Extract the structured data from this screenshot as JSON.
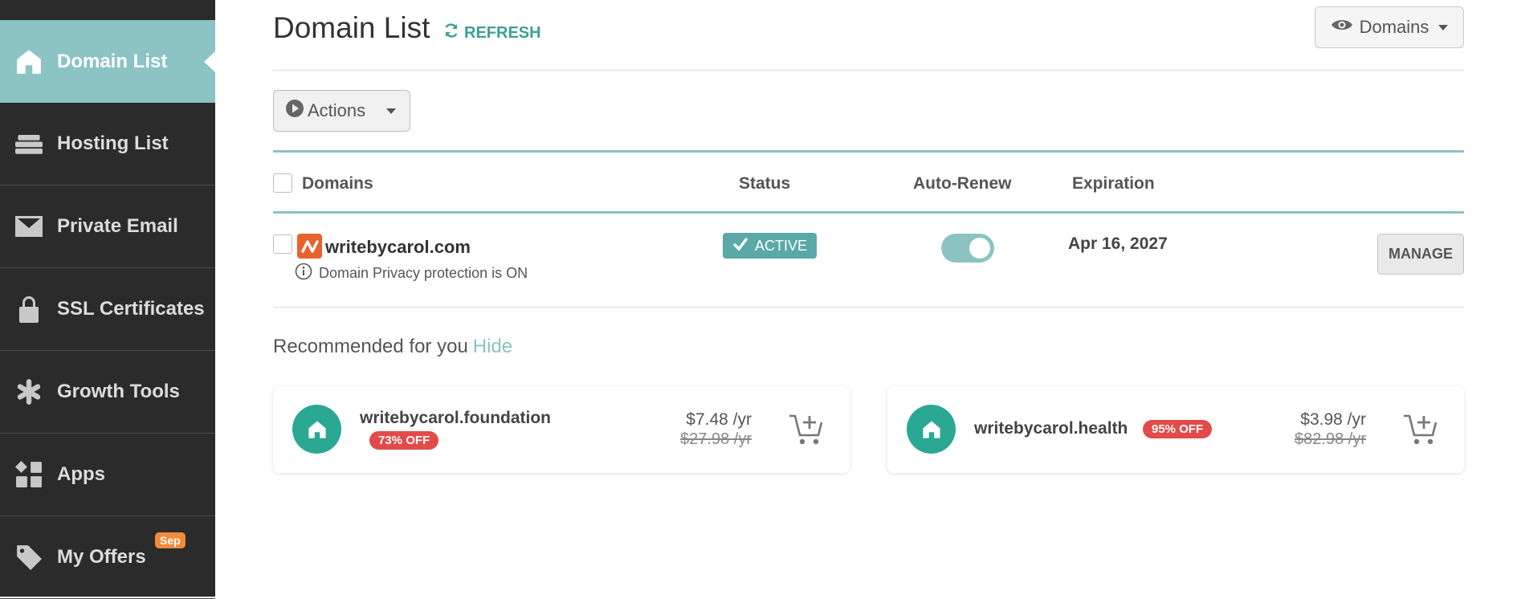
{
  "sidebar": {
    "items": [
      {
        "label": "Domain List",
        "icon": "home-icon",
        "active": true
      },
      {
        "label": "Hosting List",
        "icon": "server-icon"
      },
      {
        "label": "Private Email",
        "icon": "envelope-icon"
      },
      {
        "label": "SSL Certificates",
        "icon": "lock-icon"
      },
      {
        "label": "Growth Tools",
        "icon": "asterisk-icon"
      },
      {
        "label": "Apps",
        "icon": "apps-grid-icon"
      },
      {
        "label": "My Offers",
        "icon": "tag-icon",
        "badge": "Sep"
      }
    ]
  },
  "header": {
    "title": "Domain List",
    "refresh_label": "REFRESH",
    "view_dropdown_label": "Domains"
  },
  "toolbar": {
    "actions_label": "Actions"
  },
  "table": {
    "columns": [
      "Domains",
      "Status",
      "Auto-Renew",
      "Expiration"
    ],
    "rows": [
      {
        "domain": "writebycarol.com",
        "privacy_note": "Domain Privacy protection is ON",
        "status": "ACTIVE",
        "auto_renew": true,
        "expiration": "Apr 16, 2027",
        "manage_label": "MANAGE"
      }
    ]
  },
  "recommendations": {
    "title": "Recommended for you",
    "hide_label": "Hide",
    "cards": [
      {
        "domain": "writebycarol.foundation",
        "discount": "73% OFF",
        "price": "$7.48 /yr",
        "old_price": "$27.98 /yr"
      },
      {
        "domain": "writebycarol.health",
        "discount": "95% OFF",
        "price": "$3.98 /yr",
        "old_price": "$82.98 /yr"
      }
    ]
  },
  "colors": {
    "sidebar_bg": "#2b2b2b",
    "accent_teal": "#8cc3c3",
    "active_badge": "#5aa8a8",
    "discount_red": "#e34a4a",
    "reco_icon_green": "#2aa894",
    "offer_badge_orange": "#f28a3c"
  }
}
